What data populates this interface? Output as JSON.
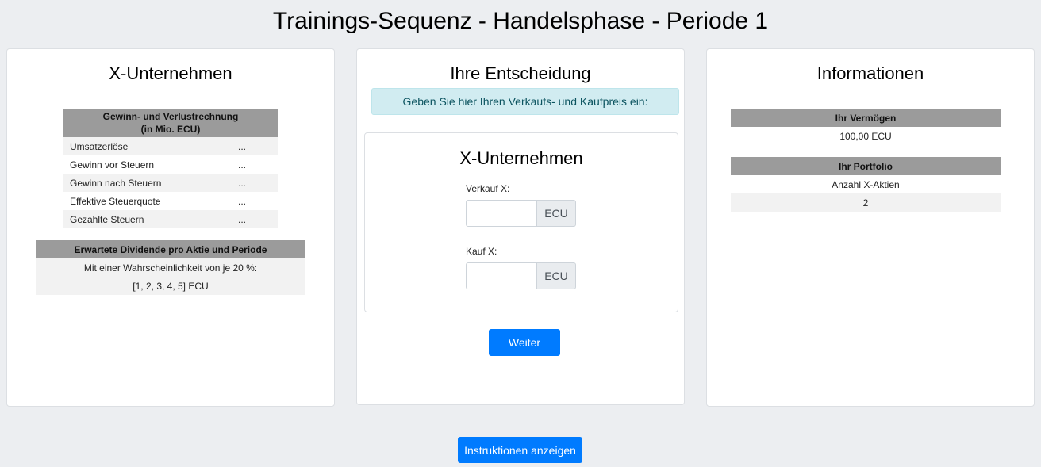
{
  "page": {
    "title": "Trainings-Sequenz - Handelsphase - Periode 1"
  },
  "company_panel": {
    "title": "X-Unternehmen",
    "pl_header_line1": "Gewinn- und Verlustrechnung",
    "pl_header_line2": "(in Mio. ECU)",
    "pl_rows": [
      {
        "label": "Umsatzerlöse",
        "value": "..."
      },
      {
        "label": "Gewinn vor Steuern",
        "value": "..."
      },
      {
        "label": "Gewinn nach Steuern",
        "value": "..."
      },
      {
        "label": "Effektive Steuerquote",
        "value": "..."
      },
      {
        "label": "Gezahlte Steuern",
        "value": "..."
      }
    ],
    "dividend_header": "Erwartete Dividende pro Aktie und Periode",
    "dividend_line1": "Mit einer Wahrscheinlichkeit von je 20 %:",
    "dividend_line2": "[1, 2, 3, 4, 5] ECU"
  },
  "decision_panel": {
    "title": "Ihre Entscheidung",
    "alert": "Geben Sie hier Ihren Verkaufs- und Kaufpreis ein:",
    "form_title": "X-Unternehmen",
    "sell_label": "Verkauf X:",
    "sell_value": "",
    "buy_label": "Kauf X:",
    "buy_value": "",
    "currency": "ECU",
    "next_button": "Weiter"
  },
  "info_panel": {
    "title": "Informationen",
    "wealth_header": "Ihr Vermögen",
    "wealth_value": "100,00 ECU",
    "portfolio_header": "Ihr Portfolio",
    "portfolio_label": "Anzahl X-Aktien",
    "portfolio_value": "2"
  },
  "footer": {
    "instructions_button": "Instruktionen anzeigen"
  }
}
